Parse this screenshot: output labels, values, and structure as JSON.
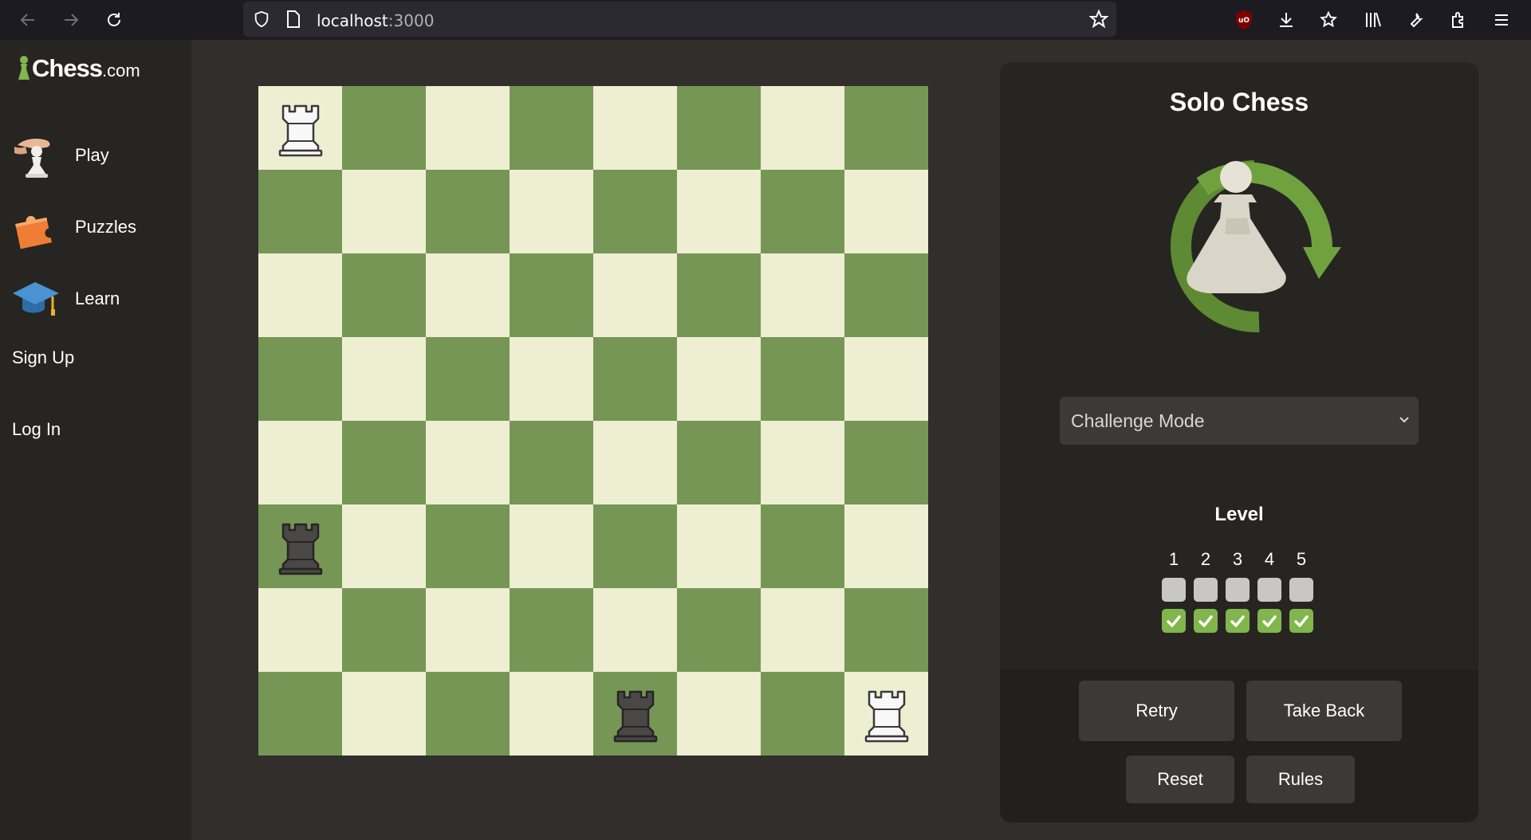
{
  "browser": {
    "url_host": "localhost",
    "url_port": ":3000"
  },
  "sidebar": {
    "logo_main": "Chess",
    "logo_suffix": ".com",
    "items": [
      {
        "label": "Play",
        "icon": "hand-pawn-icon"
      },
      {
        "label": "Puzzles",
        "icon": "puzzle-piece-icon"
      },
      {
        "label": "Learn",
        "icon": "graduation-cap-icon"
      }
    ],
    "signup": "Sign Up",
    "login": "Log In"
  },
  "board": {
    "light_color": "#eeeed2",
    "dark_color": "#769656",
    "pieces": [
      {
        "square": "a8",
        "piece": "white-rook"
      },
      {
        "square": "a3",
        "piece": "black-rook"
      },
      {
        "square": "e1",
        "piece": "black-rook"
      },
      {
        "square": "h1",
        "piece": "white-rook"
      }
    ]
  },
  "panel": {
    "title": "Solo Chess",
    "mode_selected": "Challenge Mode",
    "level_title": "Level",
    "levels": [
      "1",
      "2",
      "3",
      "4",
      "5"
    ],
    "levels_completed": 5,
    "buttons": {
      "retry": "Retry",
      "take_back": "Take Back",
      "reset": "Reset",
      "rules": "Rules"
    }
  },
  "colors": {
    "accent_green": "#81b64c",
    "background": "#312e2b",
    "panel": "#262522"
  }
}
